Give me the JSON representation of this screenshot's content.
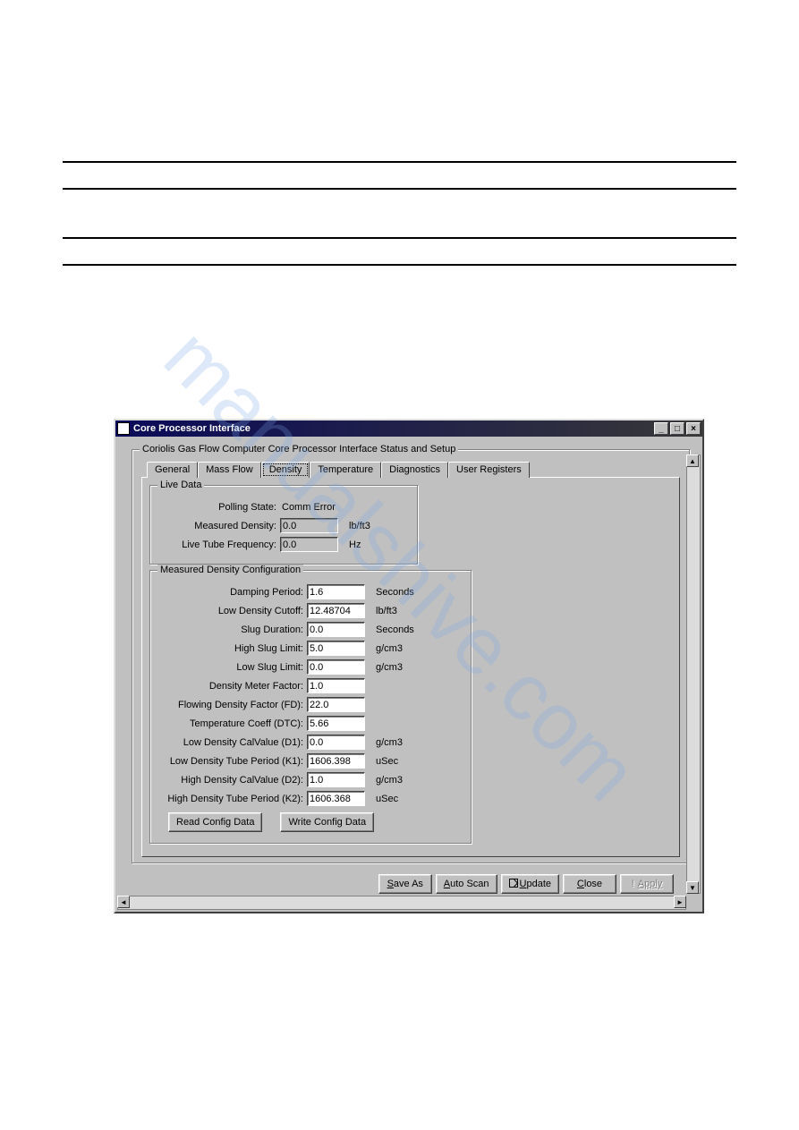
{
  "watermark": "manualshive.com",
  "window": {
    "title": "Core Processor Interface"
  },
  "group_main_legend": "Coriolis Gas Flow Computer Core Processor Interface Status and Setup",
  "tabs": {
    "items": [
      "General",
      "Mass Flow",
      "Density",
      "Temperature",
      "Diagnostics",
      "User Registers"
    ],
    "active_index": 2
  },
  "live_data": {
    "legend": "Live Data",
    "polling_state_label": "Polling State:",
    "polling_state_value": "Comm Error",
    "measured_density_label": "Measured Density:",
    "measured_density_value": "0.0",
    "measured_density_unit": "lb/ft3",
    "live_tube_freq_label": "Live Tube Frequency:",
    "live_tube_freq_value": "0.0",
    "live_tube_freq_unit": "Hz"
  },
  "config": {
    "legend": "Measured Density Configuration",
    "damping_period": {
      "label": "Damping Period:",
      "value": "1.6",
      "unit": "Seconds"
    },
    "low_density_cutoff": {
      "label": "Low Density Cutoff:",
      "value": "12.48704",
      "unit": "lb/ft3"
    },
    "slug_duration": {
      "label": "Slug Duration:",
      "value": "0.0",
      "unit": "Seconds"
    },
    "high_slug_limit": {
      "label": "High Slug Limit:",
      "value": "5.0",
      "unit": "g/cm3"
    },
    "low_slug_limit": {
      "label": "Low Slug Limit:",
      "value": "0.0",
      "unit": "g/cm3"
    },
    "density_meter_factor": {
      "label": "Density Meter Factor:",
      "value": "1.0",
      "unit": ""
    },
    "flowing_density_factor": {
      "label": "Flowing Density Factor (FD):",
      "value": "22.0",
      "unit": ""
    },
    "temperature_coeff": {
      "label": "Temperature Coeff (DTC):",
      "value": "5.66",
      "unit": ""
    },
    "low_density_calvalue": {
      "label": "Low Density CalValue (D1):",
      "value": "0.0",
      "unit": "g/cm3"
    },
    "low_density_tube_period": {
      "label": "Low Density Tube Period (K1):",
      "value": "1606.398",
      "unit": "uSec"
    },
    "high_density_calvalue": {
      "label": "High Density CalValue (D2):",
      "value": "1.0",
      "unit": "g/cm3"
    },
    "high_density_tube_period": {
      "label": "High Density Tube Period (K2):",
      "value": "1606.368",
      "unit": "uSec"
    },
    "read_btn": "Read Config Data",
    "write_btn": "Write Config Data"
  },
  "buttons": {
    "save_as": "Save As",
    "auto_scan": "Auto Scan",
    "update": "Update",
    "close": "Close",
    "apply": "Apply"
  }
}
